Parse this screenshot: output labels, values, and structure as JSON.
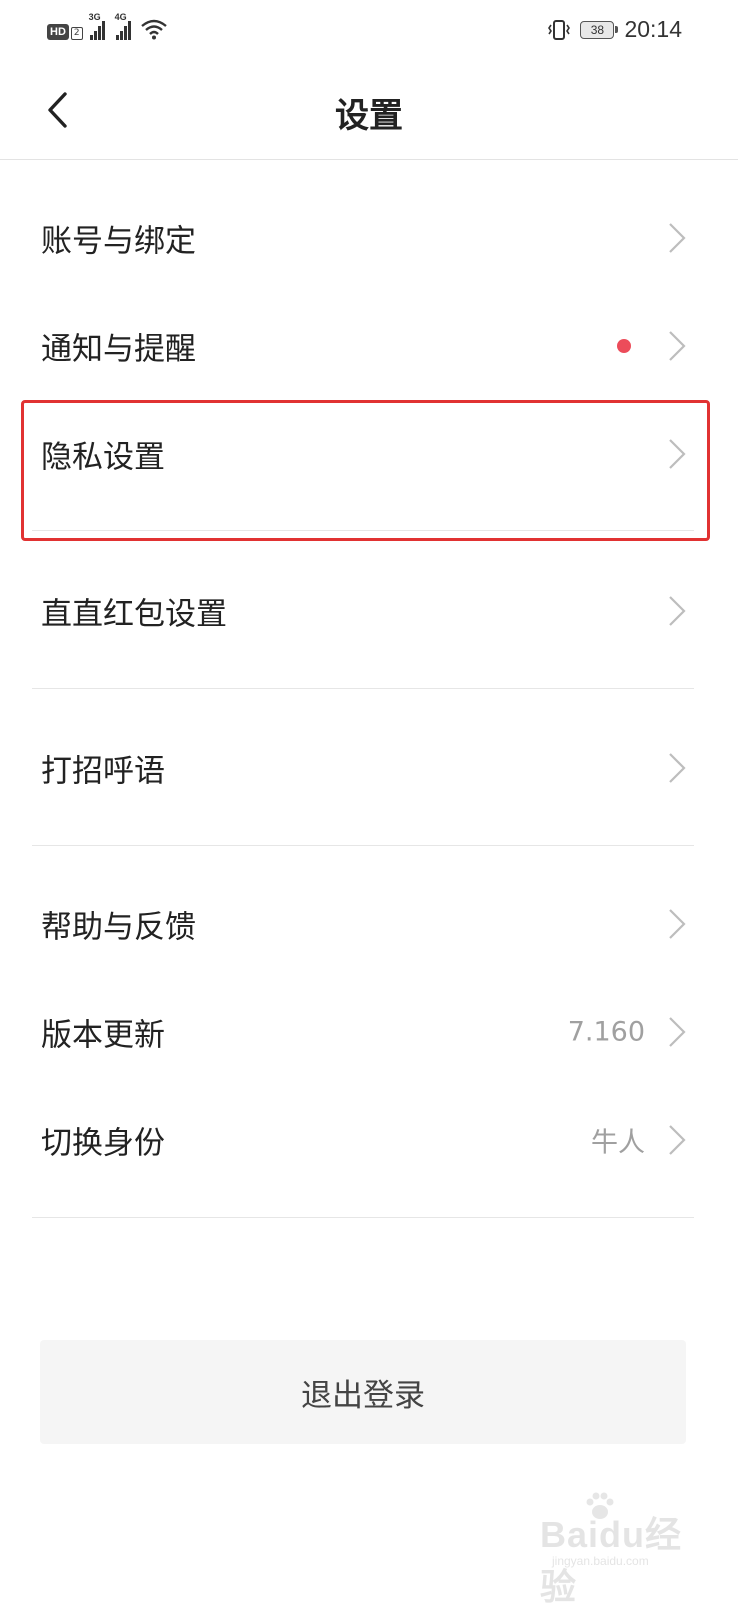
{
  "status_bar": {
    "hd_label": "HD",
    "hd_sub": "2",
    "net1_label": "3G",
    "net2_label": "4G",
    "battery": "38",
    "time": "20:14"
  },
  "header": {
    "title": "设置"
  },
  "settings": {
    "items": [
      {
        "label": "账号与绑定"
      },
      {
        "label": "通知与提醒"
      },
      {
        "label": "隐私设置"
      },
      {
        "label": "直直红包设置"
      },
      {
        "label": "打招呼语"
      },
      {
        "label": "帮助与反馈"
      },
      {
        "label": "版本更新",
        "value": "7.160"
      },
      {
        "label": "切换身份",
        "value": "牛人"
      }
    ]
  },
  "logout_label": "退出登录",
  "watermark": {
    "text": "Baidu经验",
    "sub": "jingyan.baidu.com"
  },
  "colors": {
    "highlight_border": "#e13232",
    "notification_dot": "#ec4c5a",
    "secondary_text": "#a0a0a0"
  },
  "icons": [
    "back-arrow-icon",
    "chevron-right-icon",
    "signal-icon",
    "wifi-icon",
    "vibrate-icon",
    "battery-icon"
  ]
}
